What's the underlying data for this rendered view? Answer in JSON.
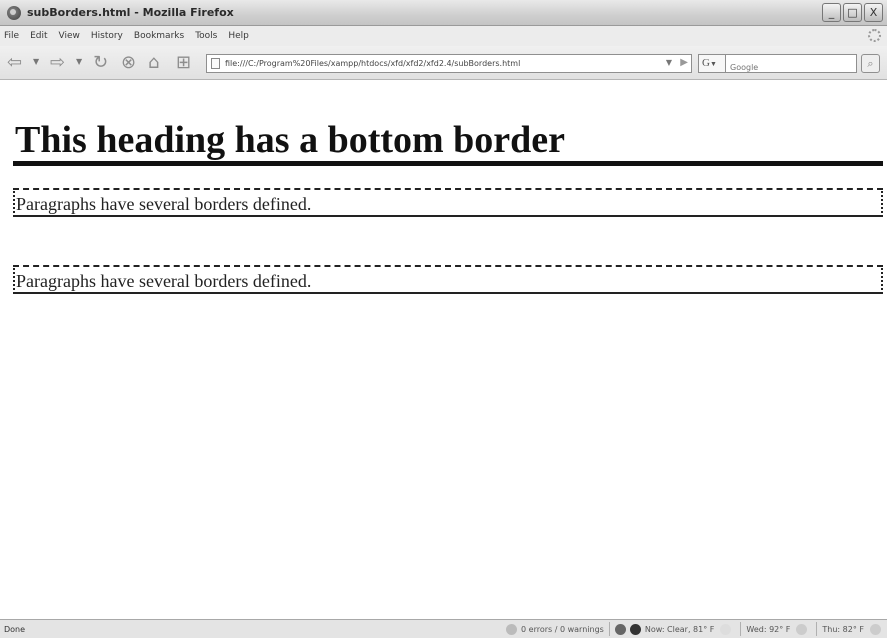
{
  "window": {
    "title": "subBorders.html - Mozilla Firefox",
    "controls": [
      "_",
      "□",
      "X"
    ]
  },
  "menu": [
    "File",
    "Edit",
    "View",
    "History",
    "Bookmarks",
    "Tools",
    "Help"
  ],
  "nav": {
    "url": "file:///C:/Program%20Files/xampp/htdocs/xfd/xfd2/xfd2.4/subBorders.html",
    "search_engine": "G",
    "search_placeholder": "Google"
  },
  "page": {
    "heading": "This heading has a bottom border",
    "paragraphs": [
      "Paragraphs have several borders defined.",
      "Paragraphs have several borders defined."
    ]
  },
  "status": {
    "left": "Done",
    "errors": "0 errors / 0 warnings",
    "weather_now": "Now: Clear, 81° F",
    "weather_wed": "Wed: 92° F",
    "weather_thu": "Thu: 82° F"
  },
  "colors": {
    "titlebar": "#cfcfcf",
    "page_background": "#ffffff",
    "border": "#222222"
  }
}
